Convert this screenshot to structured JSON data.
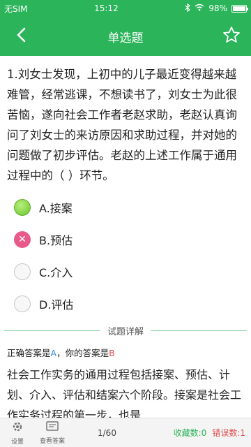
{
  "status": {
    "carrier": "无SIM",
    "time": "15:12",
    "battery": "98%",
    "battery_level": 0.98
  },
  "nav": {
    "title": "单选题"
  },
  "question": {
    "text": "1.刘女士发现，上初中的儿子最近变得越来越难管，经常逃课，不想读书了，刘女士为此很苦恼，遂向社会工作者老赵求助，老赵认真询问了刘女士的来访原因和求助过程，并对她的问题做了初步评估。老赵的上述工作属于通用过程中的（ ）环节。"
  },
  "options": [
    {
      "label": "A.接案",
      "state": "correct"
    },
    {
      "label": "B.预估",
      "state": "wrong"
    },
    {
      "label": "C.介入",
      "state": "empty"
    },
    {
      "label": "D.评估",
      "state": "empty"
    }
  ],
  "detail": {
    "heading": "试题详解",
    "correct_prefix": "正确答案是",
    "correct_answer": "A",
    "user_prefix": "，你的答案是",
    "user_answer": "B",
    "explanation": "社会工作实务的通用过程包括接案、预估、计划、介入、评估和结案六个阶段。接案是社会工作实务过程的第一步，也是"
  },
  "bottom": {
    "settings_label": "设置",
    "view_label": "查看答案",
    "progress": "1/60",
    "fav_count": "收藏数:0",
    "err_count": "错误数:1"
  },
  "colors": {
    "primary": "#2bb45a",
    "correct": "#2f8de4",
    "wrong": "#e14d4d"
  }
}
